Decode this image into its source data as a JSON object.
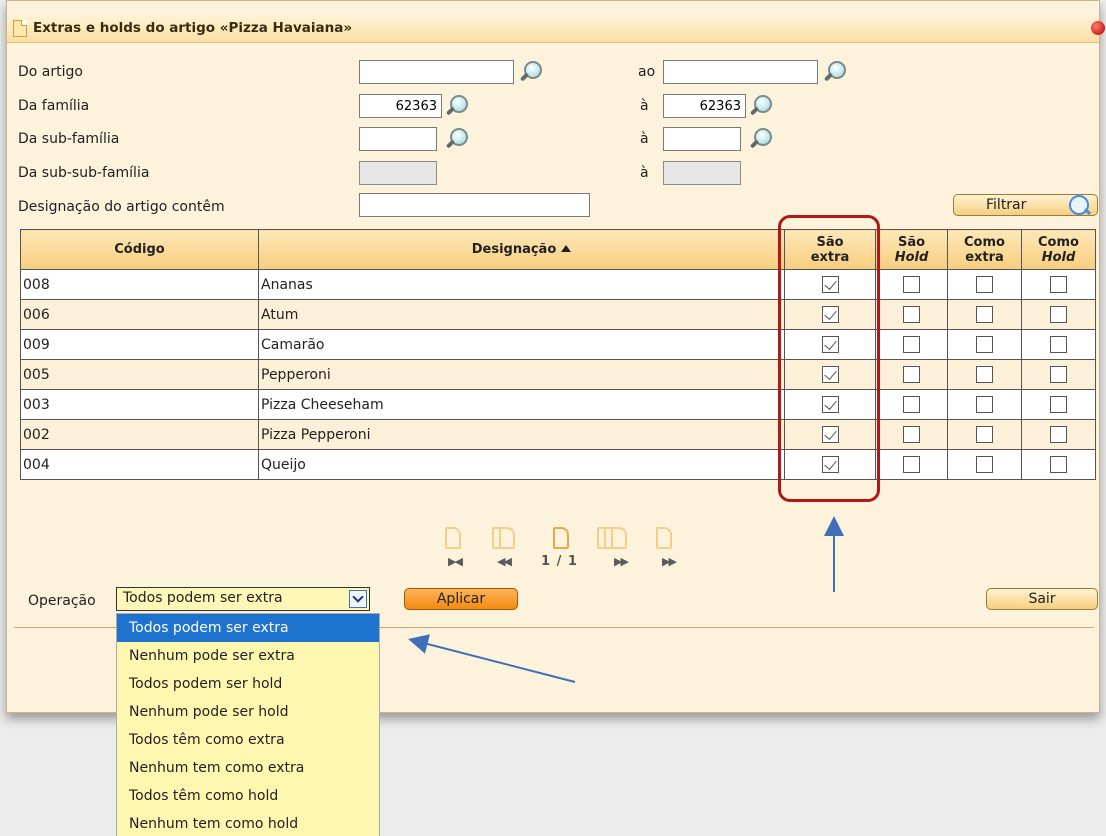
{
  "window": {
    "title": "Extras e holds do artigo «Pizza Havaiana»"
  },
  "filters": {
    "do_artigo": {
      "label": "Do artigo",
      "value": ""
    },
    "ao_artigo": {
      "label": "ao",
      "value": ""
    },
    "da_familia": {
      "label": "Da família",
      "value": "62363"
    },
    "a_familia": {
      "label": "à",
      "value": "62363"
    },
    "da_subfamilia": {
      "label": "Da sub-família",
      "value": ""
    },
    "a_subfamilia": {
      "label": "à",
      "value": ""
    },
    "da_subsubfamilia": {
      "label": "Da sub-sub-família",
      "value": ""
    },
    "a_subsubfamilia": {
      "label": "à",
      "value": ""
    },
    "designacao": {
      "label": "Designação do artigo contêm",
      "value": ""
    },
    "filter_button": "Filtrar"
  },
  "table": {
    "headers": {
      "codigo": "Código",
      "designacao": "Designação",
      "sao_extra_1": "São",
      "sao_extra_2": "extra",
      "sao_hold_1": "São",
      "sao_hold_2": "Hold",
      "como_extra_1": "Como",
      "como_extra_2": "extra",
      "como_hold_1": "Como",
      "como_hold_2": "Hold"
    },
    "rows": [
      {
        "codigo": "008",
        "designacao": "Ananas"
      },
      {
        "codigo": "006",
        "designacao": "Atum"
      },
      {
        "codigo": "009",
        "designacao": "Camarão"
      },
      {
        "codigo": "005",
        "designacao": "Pepperoni"
      },
      {
        "codigo": "003",
        "designacao": "Pizza Cheeseham"
      },
      {
        "codigo": "002",
        "designacao": "Pizza Pepperoni"
      },
      {
        "codigo": "004",
        "designacao": "Queijo"
      }
    ]
  },
  "pagination": {
    "text": "1 / 1"
  },
  "operation": {
    "label": "Operação",
    "selected": "Todos podem ser extra",
    "options": [
      "Todos podem ser extra",
      "Nenhum pode ser extra",
      "Todos podem ser hold",
      "Nenhum pode ser hold",
      "Todos têm como extra",
      "Nenhum tem como extra",
      "Todos têm como hold",
      "Nenhum tem como hold"
    ],
    "apply_button": "Aplicar",
    "exit_button": "Sair"
  },
  "colors": {
    "panel": "#fdf2dc",
    "header": "#f8ce7e",
    "highlight": "#b21818",
    "arrow": "#3f6fb8",
    "selected_option": "#1e73cf"
  }
}
